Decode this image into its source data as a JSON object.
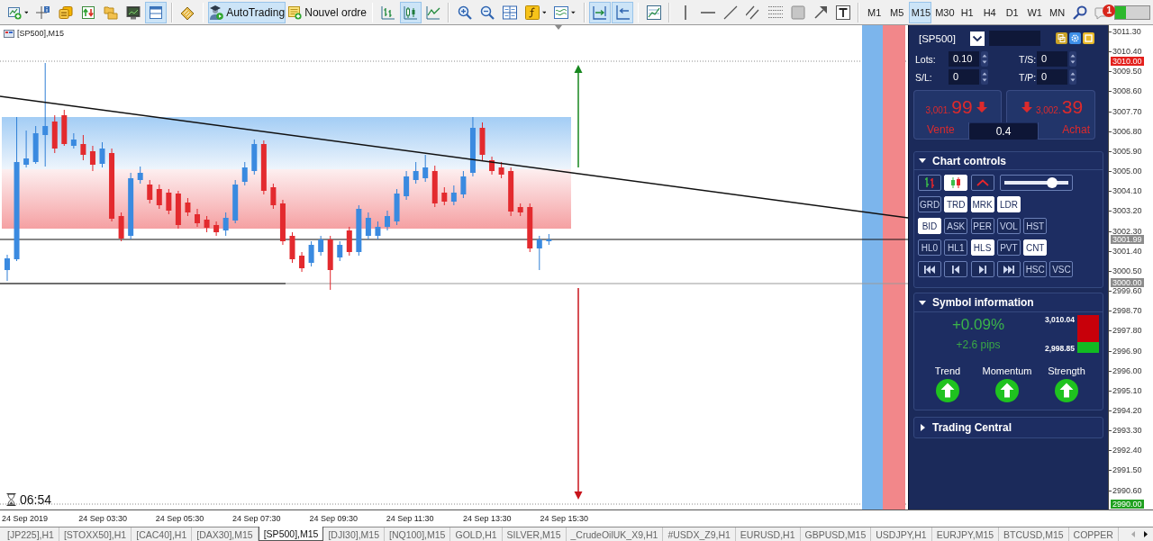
{
  "toolbar": {
    "groups": [
      [
        {
          "pressed": false,
          "menu": true
        },
        {
          "pressed": false,
          "menu": false
        },
        {
          "pressed": false,
          "menu": false
        },
        {
          "pressed": false,
          "menu": false
        },
        {
          "pressed": false,
          "menu": false
        },
        {
          "pressed": false,
          "menu": false
        },
        {
          "pressed": true,
          "menu": false
        }
      ],
      [
        {
          "pressed": false,
          "menu": false
        }
      ],
      [
        {
          "label": "AutoTrading",
          "pressed": true,
          "menu": false
        },
        {
          "label": "Nouvel ordre",
          "pressed": false,
          "menu": false
        }
      ],
      [
        {
          "pressed": false,
          "menu": false
        },
        {
          "pressed": true,
          "menu": false
        },
        {
          "pressed": false,
          "menu": false
        }
      ],
      [
        {
          "pressed": false,
          "menu": false
        },
        {
          "pressed": false,
          "menu": false
        },
        {
          "pressed": false,
          "menu": false
        },
        {
          "pressed": false,
          "menu": true
        },
        {
          "pressed": false,
          "menu": true
        }
      ],
      [
        {
          "pressed": true,
          "menu": false
        },
        {
          "pressed": true,
          "menu": false
        }
      ],
      [
        {
          "pressed": false,
          "menu": false
        }
      ],
      [
        {
          "pressed": false,
          "menu": false
        },
        {
          "pressed": false,
          "menu": false
        },
        {
          "pressed": false,
          "menu": false
        },
        {
          "pressed": false,
          "menu": false
        },
        {
          "pressed": false,
          "menu": false
        },
        {
          "pressed": false,
          "menu": false
        },
        {
          "pressed": false,
          "menu": false
        },
        {
          "pressed": false,
          "menu": false
        }
      ]
    ],
    "timeframes": [
      {
        "label": "M1",
        "selected": false
      },
      {
        "label": "M5",
        "selected": false
      },
      {
        "label": "M15",
        "selected": true
      },
      {
        "label": "M30",
        "selected": false
      },
      {
        "label": "H1",
        "selected": false
      },
      {
        "label": "H4",
        "selected": false
      },
      {
        "label": "D1",
        "selected": false
      },
      {
        "label": "W1",
        "selected": false
      },
      {
        "label": "MN",
        "selected": false
      }
    ],
    "alerts": {
      "count": "1"
    }
  },
  "chart": {
    "symbol": "[SP500],M15",
    "countdown": "06:54",
    "price_axis": {
      "labels": [
        "3011.30",
        "3010.40",
        "3009.50",
        "3008.60",
        "3007.70",
        "3006.80",
        "3005.90",
        "3005.00",
        "3004.10",
        "3003.20",
        "3002.30",
        "3001.40",
        "3000.50",
        "2999.60",
        "2998.70",
        "2997.80",
        "2996.90",
        "2996.00",
        "2995.10",
        "2994.20",
        "2993.30",
        "2992.40",
        "2991.50",
        "2990.60"
      ],
      "markers": [
        {
          "value": "3010.00",
          "color": "#e3201c"
        },
        {
          "value": "3001.99",
          "color": "#8c8c8c"
        },
        {
          "value": "3000.00",
          "color": "#8c8c8c"
        },
        {
          "value": "2990.00",
          "color": "#1fa01f"
        }
      ]
    },
    "time_axis": {
      "labels": [
        "24 Sep 2019",
        "24 Sep 03:30",
        "24 Sep 05:30",
        "24 Sep 07:30",
        "24 Sep 09:30",
        "24 Sep 11:30",
        "24 Sep 13:30",
        "24 Sep 15:30"
      ]
    }
  },
  "trade_panel": {
    "symbol": "[SP500]",
    "fields": [
      {
        "label": "Lots:",
        "value": "0.10"
      },
      {
        "label": "T/S:",
        "value": "0"
      },
      {
        "label": "S/L:",
        "value": "0"
      },
      {
        "label": "T/P:",
        "value": "0"
      }
    ],
    "sell": {
      "price": "3,001.",
      "pips": "99",
      "label": "Vente",
      "up": false
    },
    "buy": {
      "price": "3,002.",
      "pips": "39",
      "label": "Achat",
      "up": false
    },
    "spread": "0.4"
  },
  "chart_controls": {
    "title": "Chart controls",
    "expanded": true,
    "chart_types": [
      {
        "selected": false
      },
      {
        "selected": true
      },
      {
        "selected": false
      }
    ],
    "slider": {
      "level": 0.75
    },
    "rows": [
      [
        {
          "kind": "text",
          "label": "GRD",
          "on": false
        },
        {
          "kind": "text",
          "label": "TRD",
          "on": true
        },
        {
          "kind": "text",
          "label": "MRK",
          "on": true
        },
        {
          "kind": "text",
          "label": "LDR",
          "on": true
        }
      ],
      [
        {
          "kind": "text",
          "label": "BID",
          "on": true
        },
        {
          "kind": "text",
          "label": "ASK",
          "on": false
        },
        {
          "kind": "text",
          "label": "PER",
          "on": false
        },
        {
          "kind": "text",
          "label": "VOL",
          "on": false
        },
        {
          "kind": "text",
          "label": "HST",
          "on": false
        }
      ],
      [
        {
          "kind": "text",
          "label": "HL0",
          "on": false
        },
        {
          "kind": "text",
          "label": "HL1",
          "on": false
        },
        {
          "kind": "text",
          "label": "HLS",
          "on": true
        },
        {
          "kind": "text",
          "label": "PVT",
          "on": false
        },
        {
          "kind": "text",
          "label": "CNT",
          "on": true
        }
      ],
      [
        {
          "kind": "icon",
          "on": false
        },
        {
          "kind": "icon",
          "on": false
        },
        {
          "kind": "icon",
          "on": false
        },
        {
          "kind": "icon",
          "on": false
        },
        {
          "kind": "text",
          "label": "HSC",
          "on": false
        },
        {
          "kind": "text",
          "label": "VSC",
          "on": false
        }
      ]
    ]
  },
  "symbol_info": {
    "title": "Symbol information",
    "expanded": true,
    "change": "+0.09%",
    "pips": "+2.6 pips",
    "high": "3,010.04",
    "low": "2,998.85",
    "range": {
      "level": 0.28
    },
    "signals": [
      {
        "label": "Trend",
        "up": true
      },
      {
        "label": "Momentum",
        "up": true
      },
      {
        "label": "Strength",
        "up": true
      }
    ]
  },
  "trading_central": {
    "title": "Trading Central",
    "expanded": false
  },
  "tabs": {
    "items": [
      {
        "label": "[JP225],H1",
        "selected": false
      },
      {
        "label": "[STOXX50],H1",
        "selected": false
      },
      {
        "label": "[CAC40],H1",
        "selected": false
      },
      {
        "label": "[DAX30],M15",
        "selected": false
      },
      {
        "label": "[SP500],M15",
        "selected": true
      },
      {
        "label": "[DJI30],M15",
        "selected": false
      },
      {
        "label": "[NQ100],M15",
        "selected": false
      },
      {
        "label": "GOLD,H1",
        "selected": false
      },
      {
        "label": "SILVER,M15",
        "selected": false
      },
      {
        "label": "_CrudeOilUK_X9,H1",
        "selected": false
      },
      {
        "label": "#USDX_Z9,H1",
        "selected": false
      },
      {
        "label": "EURUSD,H1",
        "selected": false
      },
      {
        "label": "GBPUSD,M15",
        "selected": false
      },
      {
        "label": "USDJPY,H1",
        "selected": false
      },
      {
        "label": "EURJPY,M15",
        "selected": false
      },
      {
        "label": "BTCUSD,M15",
        "selected": false
      },
      {
        "label": "COPPER",
        "selected": false
      }
    ],
    "scroll": [
      {
        "disabled": true
      },
      {
        "disabled": false
      }
    ]
  }
}
